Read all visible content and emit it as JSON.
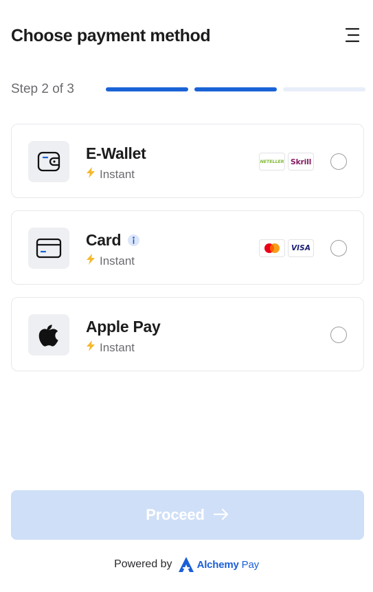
{
  "header": {
    "title": "Choose payment method",
    "menu_icon": "menu-icon"
  },
  "stepper": {
    "label": "Step 2 of 3",
    "current": 2,
    "total": 3
  },
  "methods": [
    {
      "name": "E-Wallet",
      "speed": "Instant",
      "icon": "wallet-icon",
      "logos": [
        "NETELLER",
        "Skrill"
      ],
      "selected": false
    },
    {
      "name": "Card",
      "speed": "Instant",
      "icon": "card-icon",
      "info_icon": "info-icon",
      "logos": [
        "mastercard-logo",
        "VISA"
      ],
      "selected": false
    },
    {
      "name": "Apple Pay",
      "speed": "Instant",
      "icon": "apple-icon",
      "logos": [],
      "selected": false
    }
  ],
  "proceed": {
    "label": "Proceed",
    "enabled": false,
    "arrow_icon": "arrow-right-icon"
  },
  "footer": {
    "powered_by": "Powered by",
    "brand_first": "Alchemy",
    "brand_second": "Pay"
  },
  "colors": {
    "accent": "#1a63d6",
    "step_inactive": "#e8eef9",
    "button_disabled": "#cfdff7",
    "bolt": "#f5b82e",
    "neteller": "#83ba3b",
    "skrill": "#862165",
    "visa": "#1a1f71"
  }
}
